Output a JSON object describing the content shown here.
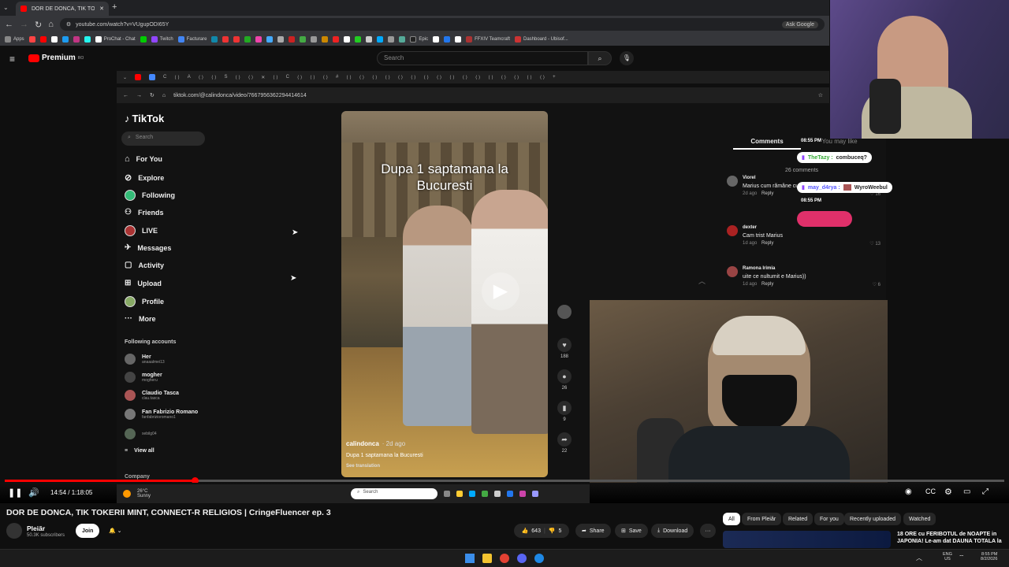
{
  "browser": {
    "tab_title": "DOR DE DONCA, TIK TOKERII",
    "url": "youtube.com/watch?v=VUgupODI65Y",
    "ask_google": "Ask Google",
    "bookmarks": [
      "Apps",
      "ProChat - Chat",
      "Twitch",
      "Facturare",
      "Epic",
      "FFXIV Teamcraft",
      "Dashboard - Ubisof..."
    ]
  },
  "youtube": {
    "brand": "Premium",
    "region": "RO",
    "search_placeholder": "Search",
    "time": "14:54 / 1:18:05",
    "title": "DOR DE DONCA, TIK TOKERII MINT, CONNECT-R RELIGIOS | CringeFluencer ep. 3",
    "channel": "Pleiăr",
    "subscribers": "50.3K subscribers",
    "join": "Join",
    "likes": "643",
    "dislikes": "5",
    "share": "Share",
    "save": "Save",
    "download": "Download",
    "chips": [
      "All",
      "From Pleiăr",
      "Related",
      "For you",
      "Recently uploaded",
      "Watched"
    ],
    "rec_title_1": "18 ORE cu FERIBOTUL de NOAPTE in",
    "rec_title_2": "JAPONIA! Le-am dat DAUNA TOTALA la",
    "progress_fraction": 0.19
  },
  "inner": {
    "url": "tiktok.com/@calindonca/video/7667956362294414614",
    "weather_temp": "26°C",
    "weather_desc": "Sunny",
    "search": "Search"
  },
  "tiktok": {
    "logo": "TikTok",
    "search": "Search",
    "nav": [
      "For You",
      "Explore",
      "Following",
      "Friends",
      "LIVE",
      "Messages",
      "Activity",
      "Upload",
      "Profile",
      "More"
    ],
    "following_header": "Following accounts",
    "accounts": [
      {
        "name": "Her",
        "user": "anaaalmei13"
      },
      {
        "name": "mogher",
        "user": "mogheru"
      },
      {
        "name": "Claudio Tasca",
        "user": "clau.tasca"
      },
      {
        "name": "Fan Fabrizio Romano",
        "user": "fanfabrizioromano1"
      },
      {
        "name": "",
        "user": "sebilg04"
      }
    ],
    "view_all": "View all",
    "company": "Company",
    "video_caption_top": "Dupa 1 saptamana la Bucuresti",
    "video_user": "calindonca",
    "video_age": "· 2d ago",
    "video_desc": "Dupa 1 saptamana la Bucuresti",
    "see_translation": "See translation",
    "likes": "188",
    "comments_count": "26",
    "saves": "9",
    "shares": "22",
    "tabs": [
      "Comments",
      "You may like"
    ],
    "comments_total": "26 comments",
    "comments": [
      {
        "user": "Viorel",
        "text": "Marius cum rămâne cu ... pentru fiecare deschidere",
        "age": "2d ago",
        "reply": "Reply",
        "likes": "16"
      },
      {
        "user": "dexter",
        "text": "Cam trist Marius",
        "age": "1d ago",
        "reply": "Reply",
        "likes": "13"
      },
      {
        "user": "Ramona Irimia",
        "text": "uite ce nultumit e Marius))",
        "age": "1d ago",
        "reply": "Reply",
        "likes": "6"
      }
    ]
  },
  "stream_chat": [
    {
      "user": "TheTazy :",
      "msg": "combuceq?",
      "time": "08:55 PM"
    },
    {
      "user": "may_d4rya :",
      "msg": "WyroWeebul",
      "time": "08:55 PM"
    }
  ],
  "taskbar": {
    "lang1": "ENG",
    "lang2": "US",
    "time": "8:55 PM",
    "date": "8/2/2026"
  }
}
